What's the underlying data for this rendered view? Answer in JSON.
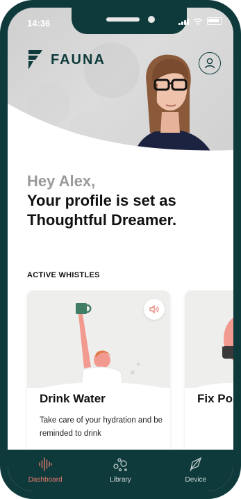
{
  "status_bar": {
    "time": "14:36"
  },
  "header": {
    "brand": "FAUNA"
  },
  "greeting": {
    "hello": "Hey Alex,",
    "line1": "Your profile is set as",
    "line2": "Thoughtful Dreamer."
  },
  "whistles": {
    "section_title": "ACTIVE WHISTLES",
    "cards": [
      {
        "title": "Drink Water",
        "description": "Take care of your hydration and be reminded to drink"
      },
      {
        "title": "Fix Pos"
      }
    ]
  },
  "tabs": [
    {
      "label": "Dashboard",
      "icon": "waveform-icon",
      "active": true
    },
    {
      "label": "Library",
      "icon": "bubbles-icon",
      "active": false
    },
    {
      "label": "Device",
      "icon": "feather-icon",
      "active": false
    }
  ],
  "colors": {
    "primary": "#0f3a3b",
    "accent": "#e4786b",
    "card_bg": "#eeeeec"
  }
}
